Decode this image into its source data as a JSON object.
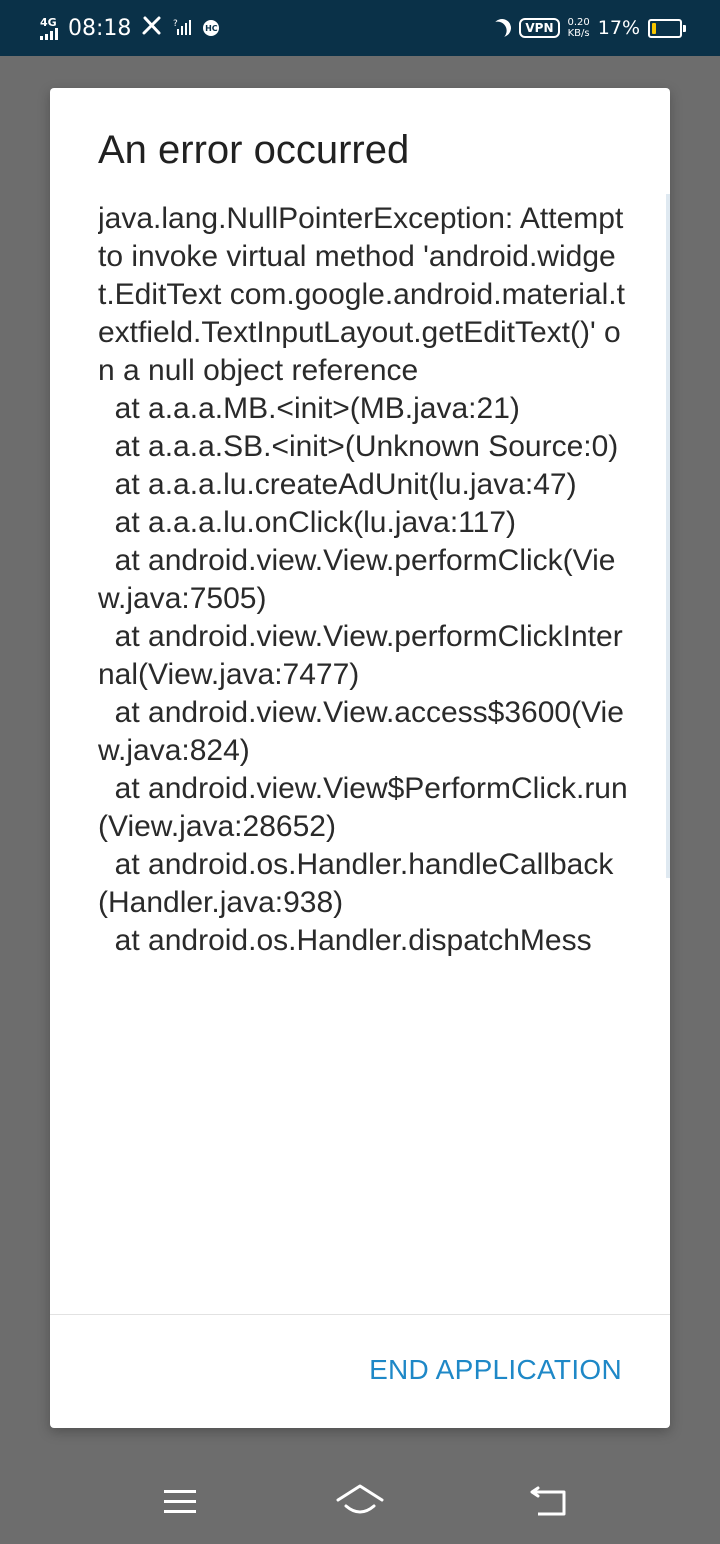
{
  "status_bar": {
    "network": "4G",
    "time": "08:18",
    "vpn": "VPN",
    "speed_value": "0.20",
    "speed_unit": "KB/s",
    "battery": "17%",
    "battery_level": 0.17,
    "icons": [
      "signal-icon",
      "tools-icon",
      "no-signal-icon",
      "notification-icon",
      "moon-icon",
      "vpn-icon",
      "battery-icon"
    ]
  },
  "dialog": {
    "title": "An error occurred",
    "stack_trace": "java.lang.NullPointerException: Attempt to invoke virtual method 'android.widget.EditText com.google.android.material.textfield.TextInputLayout.getEditText()' on a null object reference\n  at a.a.a.MB.<init>(MB.java:21)\n  at a.a.a.SB.<init>(Unknown Source:0)\n  at a.a.a.lu.createAdUnit(lu.java:47)\n  at a.a.a.lu.onClick(lu.java:117)\n  at android.view.View.performClick(View.java:7505)\n  at android.view.View.performClickInternal(View.java:7477)\n  at android.view.View.access$3600(View.java:824)\n  at android.view.View$PerformClick.run(View.java:28652)\n  at android.os.Handler.handleCallback(Handler.java:938)\n  at android.os.Handler.dispatchMess",
    "end_button": "END APPLICATION"
  },
  "colors": {
    "status_bar": "#0a3148",
    "backdrop": "#6d6d6d",
    "accent": "#1e88c7",
    "battery": "#f6c500"
  },
  "nav_bar": {
    "icons": [
      "menu-icon",
      "home-icon",
      "back-icon"
    ]
  }
}
